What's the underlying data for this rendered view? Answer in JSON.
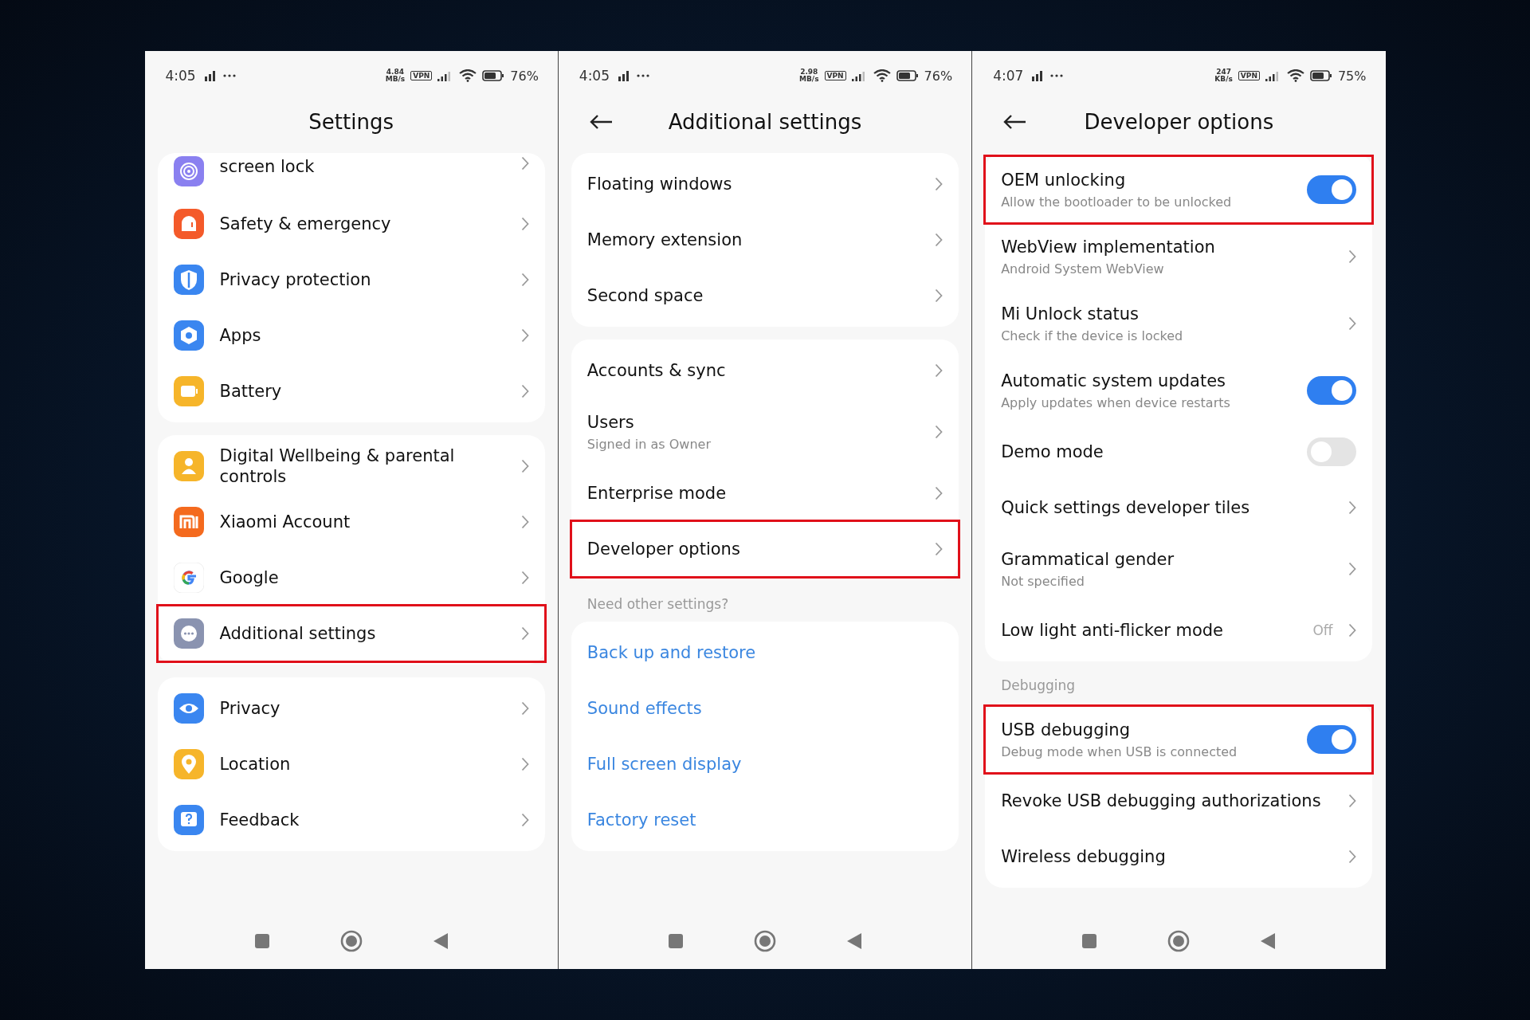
{
  "panels": [
    {
      "status": {
        "time": "4:05",
        "speed": "4.84",
        "speed_unit": "MB/s",
        "vpn": "VPN",
        "battery": "76%"
      },
      "title": "Settings",
      "back": false,
      "groups": [
        {
          "items": [
            {
              "label": "screen lock",
              "kind": "chevron",
              "highlighted": false
            },
            {
              "label": "Safety & emergency",
              "kind": "chevron",
              "highlighted": false
            },
            {
              "label": "Privacy protection",
              "kind": "chevron",
              "highlighted": false
            },
            {
              "label": "Apps",
              "kind": "chevron",
              "highlighted": false
            },
            {
              "label": "Battery",
              "kind": "chevron",
              "highlighted": false
            }
          ]
        },
        {
          "items": [
            {
              "label": "Digital Wellbeing & parental controls",
              "kind": "chevron",
              "highlighted": false
            },
            {
              "label": "Xiaomi Account",
              "kind": "chevron",
              "highlighted": false
            },
            {
              "label": "Google",
              "kind": "chevron",
              "highlighted": false
            },
            {
              "label": "Additional settings",
              "kind": "chevron",
              "highlighted": true
            }
          ]
        },
        {
          "items": [
            {
              "label": "Privacy",
              "kind": "chevron",
              "highlighted": false
            },
            {
              "label": "Location",
              "kind": "chevron",
              "highlighted": false
            },
            {
              "label": "Feedback",
              "kind": "chevron",
              "highlighted": false
            }
          ]
        }
      ]
    },
    {
      "status": {
        "time": "4:05",
        "speed": "2.98",
        "speed_unit": "MB/s",
        "vpn": "VPN",
        "battery": "76%"
      },
      "title": "Additional settings",
      "back": true,
      "groups": [
        {
          "items": [
            {
              "label": "Floating windows",
              "kind": "chevron",
              "highlighted": false
            },
            {
              "label": "Memory extension",
              "kind": "chevron",
              "highlighted": false
            },
            {
              "label": "Second space",
              "kind": "chevron",
              "highlighted": false
            }
          ]
        },
        {
          "items": [
            {
              "label": "Accounts & sync",
              "kind": "chevron",
              "highlighted": false
            },
            {
              "label": "Users",
              "sub": "Signed in as Owner",
              "kind": "chevron",
              "highlighted": false
            },
            {
              "label": "Enterprise mode",
              "kind": "chevron",
              "highlighted": false
            },
            {
              "label": "Developer options",
              "kind": "chevron",
              "highlighted": true
            }
          ]
        },
        {
          "header": "Need other settings?",
          "items": [
            {
              "label": "Back up and restore",
              "kind": "link",
              "highlighted": false
            },
            {
              "label": "Sound effects",
              "kind": "link",
              "highlighted": false
            },
            {
              "label": "Full screen display",
              "kind": "link",
              "highlighted": false
            },
            {
              "label": "Factory reset",
              "kind": "link",
              "highlighted": false
            }
          ]
        }
      ]
    },
    {
      "status": {
        "time": "4:07",
        "speed": "247",
        "speed_unit": "KB/s",
        "vpn": "VPN",
        "battery": "75%"
      },
      "title": "Developer options",
      "back": true,
      "groups": [
        {
          "items": [
            {
              "label": "OEM unlocking",
              "sub": "Allow the bootloader to be unlocked",
              "kind": "toggle",
              "on": true,
              "highlighted": true
            },
            {
              "label": "WebView implementation",
              "sub": "Android System WebView",
              "kind": "chevron",
              "highlighted": false
            },
            {
              "label": "Mi Unlock status",
              "sub": "Check if the device is locked",
              "kind": "chevron",
              "highlighted": false
            },
            {
              "label": "Automatic system updates",
              "sub": "Apply updates when device restarts",
              "kind": "toggle",
              "on": true,
              "highlighted": false
            },
            {
              "label": "Demo mode",
              "kind": "toggle",
              "on": false,
              "highlighted": false
            },
            {
              "label": "Quick settings developer tiles",
              "kind": "chevron",
              "highlighted": false
            },
            {
              "label": "Grammatical gender",
              "sub": "Not specified",
              "kind": "chevron",
              "highlighted": false
            },
            {
              "label": "Low light anti-flicker mode",
              "value": "Off",
              "kind": "chevron",
              "highlighted": false
            }
          ]
        },
        {
          "header": "Debugging",
          "items": [
            {
              "label": "USB debugging",
              "sub": "Debug mode when USB is connected",
              "kind": "toggle",
              "on": true,
              "highlighted": true
            },
            {
              "label": "Revoke USB debugging authorizations",
              "kind": "chevron",
              "highlighted": false
            },
            {
              "label": "Wireless debugging",
              "kind": "chevron",
              "highlighted": false
            }
          ]
        }
      ]
    }
  ]
}
